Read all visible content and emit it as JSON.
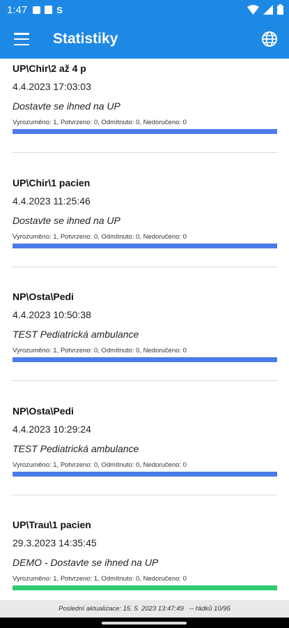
{
  "status_bar": {
    "time": "1:47",
    "s_icon_text": "S",
    "icons": [
      "notification-icon",
      "photo-icon",
      "wifi-icon",
      "signal-icon",
      "battery-icon"
    ]
  },
  "app_bar": {
    "title": "Statistiky",
    "color": "#1e88e5",
    "icons": [
      "menu-icon",
      "globe-icon"
    ]
  },
  "items": [
    {
      "title": "UP\\Chir\\2 až 4 p",
      "date": "4.4.2023 17:03:03",
      "message": "Dostavte se ihned na UP",
      "stats": "Vyrozuměno: 1, Potvrzeno: 0, Odmítnuto: 0, Nedoručeno: 0",
      "progress": 1.0,
      "bar_color": "#4a7be8"
    },
    {
      "title": "UP\\Chir\\1 pacien",
      "date": "4.4.2023 11:25:46",
      "message": "Dostavte se ihned na UP",
      "stats": "Vyrozuměno: 1, Potvrzeno: 0, Odmítnuto: 0, Nedoručeno: 0",
      "progress": 1.0,
      "bar_color": "#4a7be8"
    },
    {
      "title": "NP\\Osta\\Pedi",
      "date": "4.4.2023 10:50:38",
      "message": "TEST Pediatrická  ambulance",
      "stats": "Vyrozuměno: 1, Potvrzeno: 0, Odmítnuto: 0, Nedoručeno: 0",
      "progress": 1.0,
      "bar_color": "#4a7be8"
    },
    {
      "title": "NP\\Osta\\Pedi",
      "date": "4.4.2023 10:29:24",
      "message": "TEST Pediatrická  ambulance",
      "stats": "Vyrozuměno: 1, Potvrzeno: 0, Odmítnuto: 0, Nedoručeno: 0",
      "progress": 1.0,
      "bar_color": "#4a7be8"
    },
    {
      "title": "UP\\Trau\\1 pacien",
      "date": "29.3.2023 14:35:45",
      "message": "DEMO - Dostavte se ihned na UP",
      "stats": "Vyrozuměno: 1, Potvrzeno: 1, Odmítnuto: 0, Nedoručeno: 0",
      "progress": 1.0,
      "bar_color": "#2ecc71"
    }
  ],
  "footer": {
    "text": "Poslední aktualizace: 15. 5. 2023 13:47:49   -- řádků 10/95"
  }
}
